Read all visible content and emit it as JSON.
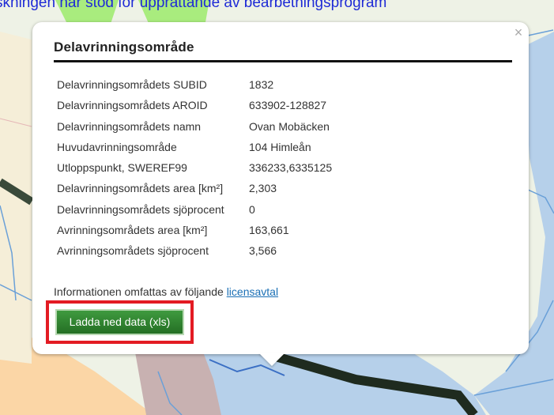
{
  "caption": "skningen har stöd för upprättande av bearbetningsprogram",
  "popup": {
    "title": "Delavrinningsområde",
    "close_icon": "close-icon",
    "rows": [
      {
        "label": "Delavrinningsområdets SUBID",
        "value": "1832"
      },
      {
        "label": "Delavrinningsområdets AROID",
        "value": "633902-128827"
      },
      {
        "label": "Delavrinningsområdets namn",
        "value": "Ovan Mobäcken"
      },
      {
        "label": "Huvudavrinningsområde",
        "value": "104 Himleån"
      },
      {
        "label": "Utloppspunkt, SWEREF99",
        "value": "336233,6335125"
      },
      {
        "label": "Delavrinningsområdets area [km²]",
        "value": "2,303"
      },
      {
        "label": "Delavrinningsområdets sjöprocent",
        "value": "0"
      },
      {
        "label": "Avrinningsområdets area [km²]",
        "value": "163,661"
      },
      {
        "label": "Avrinningsområdets sjöprocent",
        "value": "3,566"
      }
    ],
    "license_text": "Informationen omfattas av följande",
    "license_link": "licensavtal",
    "download_button": "Ladda ned data (xls)"
  },
  "colors": {
    "map_bg": "#eef2e6",
    "region_orange": "#fbd6a6",
    "region_blue": "#b6d0ea",
    "region_mauve": "#c8b1b1",
    "region_green": "#a9ec7e",
    "river_line": "#3a4a3a",
    "highlight_border": "#e31b23",
    "button_green": "#2e7d2e"
  }
}
